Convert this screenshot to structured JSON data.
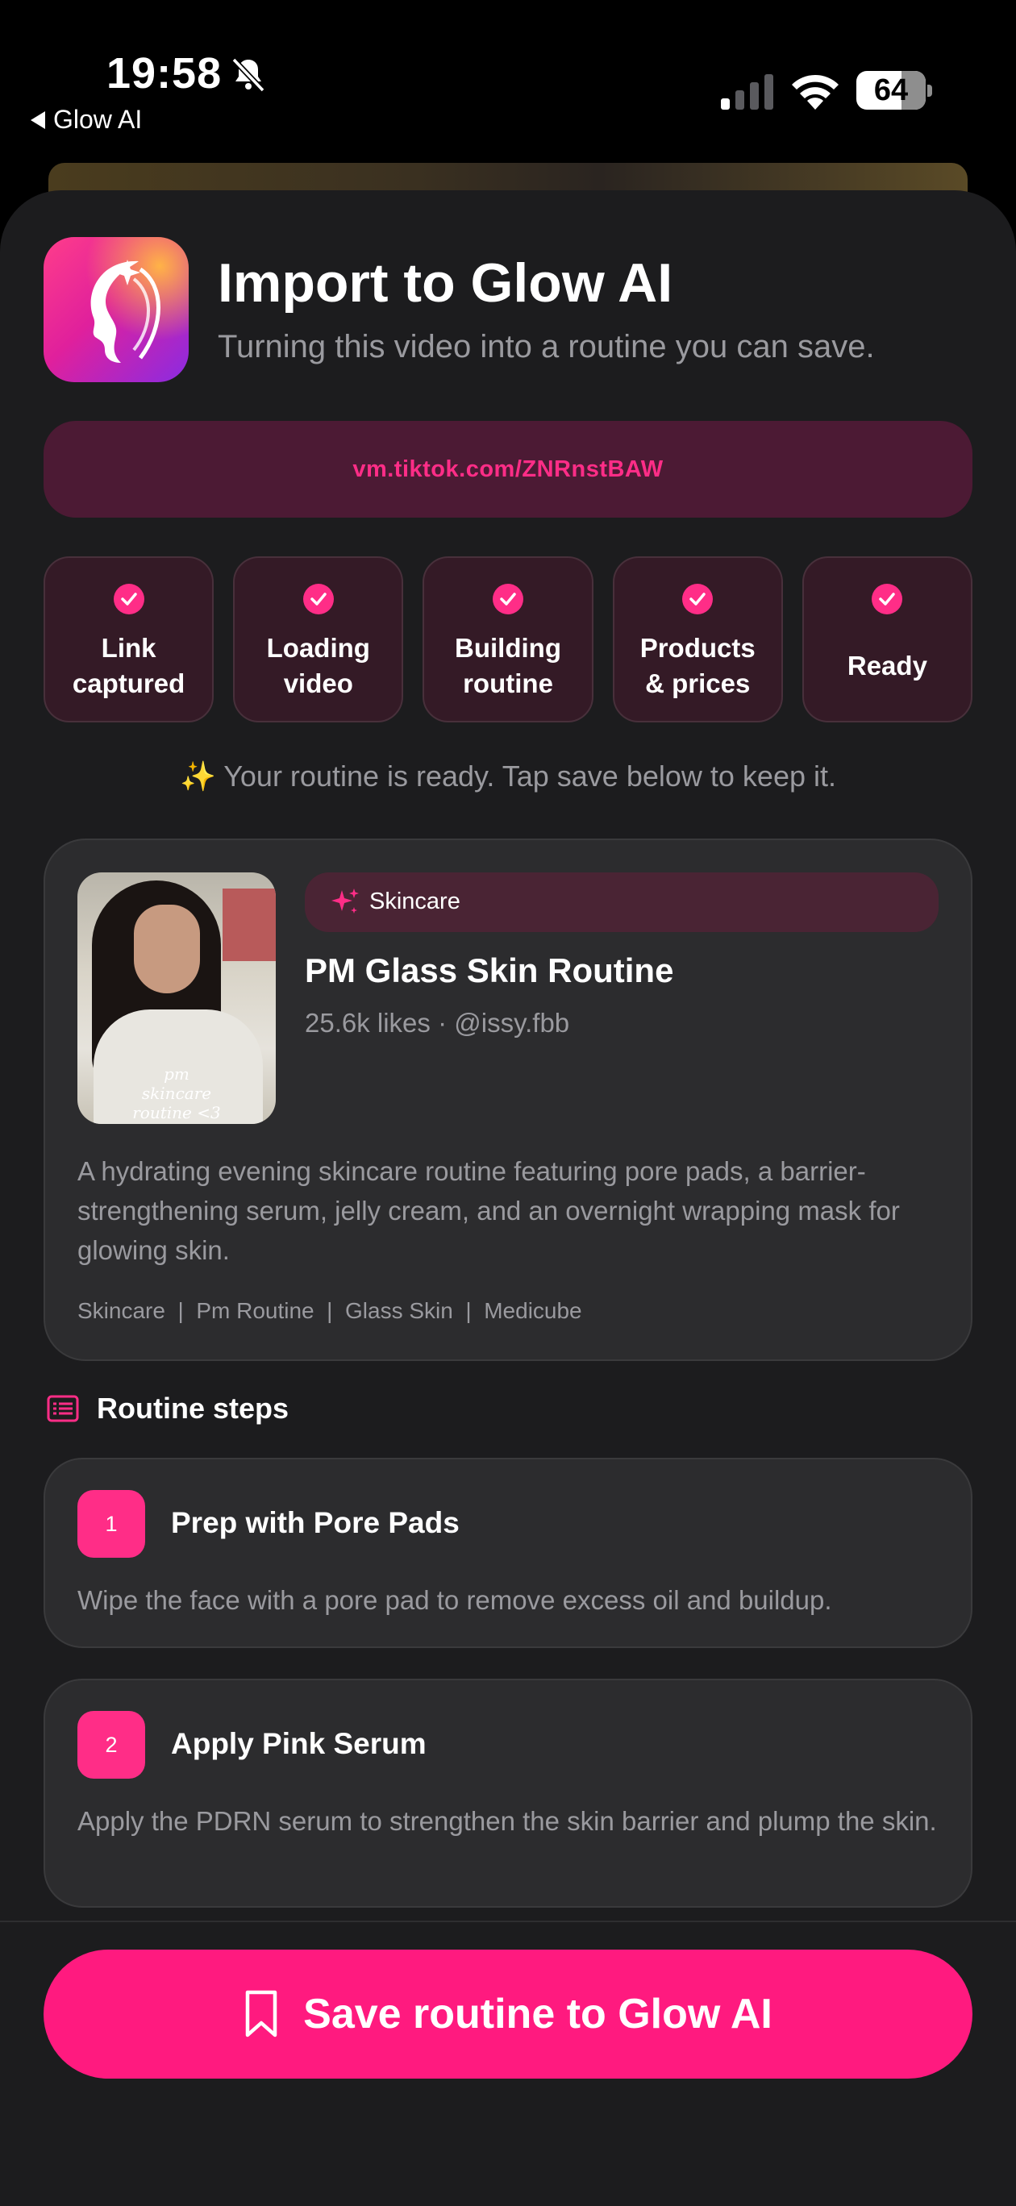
{
  "status_bar": {
    "time": "19:58",
    "back_app": "Glow AI",
    "battery": "64"
  },
  "header": {
    "title": "Import to Glow AI",
    "subtitle": "Turning this video into a routine you can save."
  },
  "url": "vm.tiktok.com/ZNRnstBAW",
  "progress_steps": [
    {
      "line1": "Link",
      "line2": "captured",
      "done": true
    },
    {
      "line1": "Loading",
      "line2": "video",
      "done": true
    },
    {
      "line1": "Building",
      "line2": "routine",
      "done": true
    },
    {
      "line1": "Products",
      "line2": "& prices",
      "done": true
    },
    {
      "line1": "Ready",
      "line2": "",
      "done": true
    }
  ],
  "ready_message": {
    "emoji": "✨",
    "text": "Your routine is ready. Tap save below to keep it."
  },
  "routine": {
    "thumbnail_caption": [
      "pm",
      "skincare",
      "routine <3"
    ],
    "category": "Skincare",
    "title": "PM Glass Skin Routine",
    "meta": "25.6k likes · @issy.fbb",
    "description": "A hydrating evening skincare routine featuring pore pads, a barrier-strengthening serum, jelly cream, and an overnight wrapping mask for glowing skin.",
    "tags": "Skincare  |  Pm Routine  |  Glass Skin  |  Medicube"
  },
  "steps_section": {
    "title": "Routine steps",
    "steps": [
      {
        "num": "1",
        "title": "Prep with Pore Pads",
        "desc": "Wipe the face with a pore pad to remove excess oil and buildup."
      },
      {
        "num": "2",
        "title": "Apply Pink Serum",
        "desc": "Apply the PDRN serum to strengthen the skin barrier and plump the skin."
      }
    ]
  },
  "save_button": "Save routine to Glow AI",
  "colors": {
    "accent": "#ff1a7f",
    "background": "#1c1c1e",
    "card": "#2c2c2e"
  },
  "icons": [
    "bell-slash-icon",
    "signal-icon",
    "wifi-icon",
    "check-icon",
    "sparkles-icon",
    "list-icon",
    "bookmark-icon"
  ]
}
